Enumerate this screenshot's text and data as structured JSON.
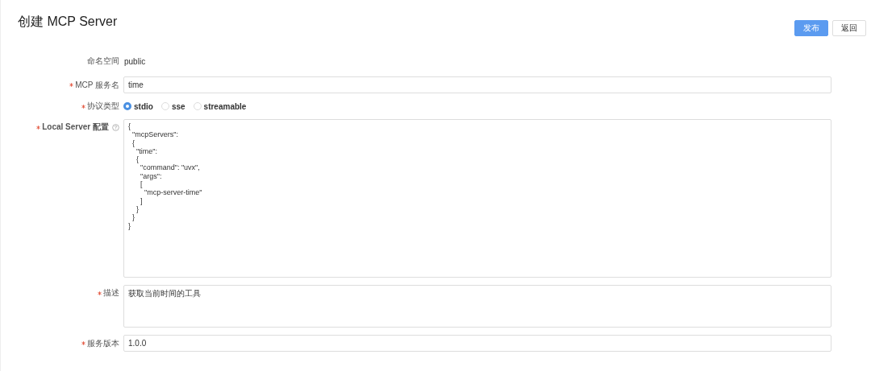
{
  "title": "创建 MCP Server",
  "actions": [
    {
      "label": "发布",
      "kind": "primary"
    },
    {
      "label": "返回",
      "kind": "default"
    }
  ],
  "form": [
    {
      "kind": "static",
      "label": "命名空间",
      "required": false,
      "value": "public"
    },
    {
      "kind": "input",
      "label": "MCP 服务名",
      "required": true,
      "value": "time"
    },
    {
      "kind": "radio",
      "label": "协议类型",
      "required": true,
      "options": [
        {
          "label": "stdio",
          "selected": true
        },
        {
          "label": "sse",
          "selected": false
        },
        {
          "label": "streamable",
          "selected": false
        }
      ]
    },
    {
      "kind": "code",
      "label": "Local Server 配置",
      "required": true,
      "help": true,
      "value": "{\n  \"mcpServers\":\n  {\n    \"time\":\n    {\n      \"command\": \"uvx\",\n      \"args\":\n      [\n        \"mcp-server-time\"\n      ]\n    }\n  }\n}"
    },
    {
      "kind": "textarea",
      "label": "描述",
      "required": true,
      "value": "获取当前时间的工具"
    },
    {
      "kind": "input",
      "label": "服务版本",
      "required": true,
      "value": "1.0.0"
    }
  ]
}
